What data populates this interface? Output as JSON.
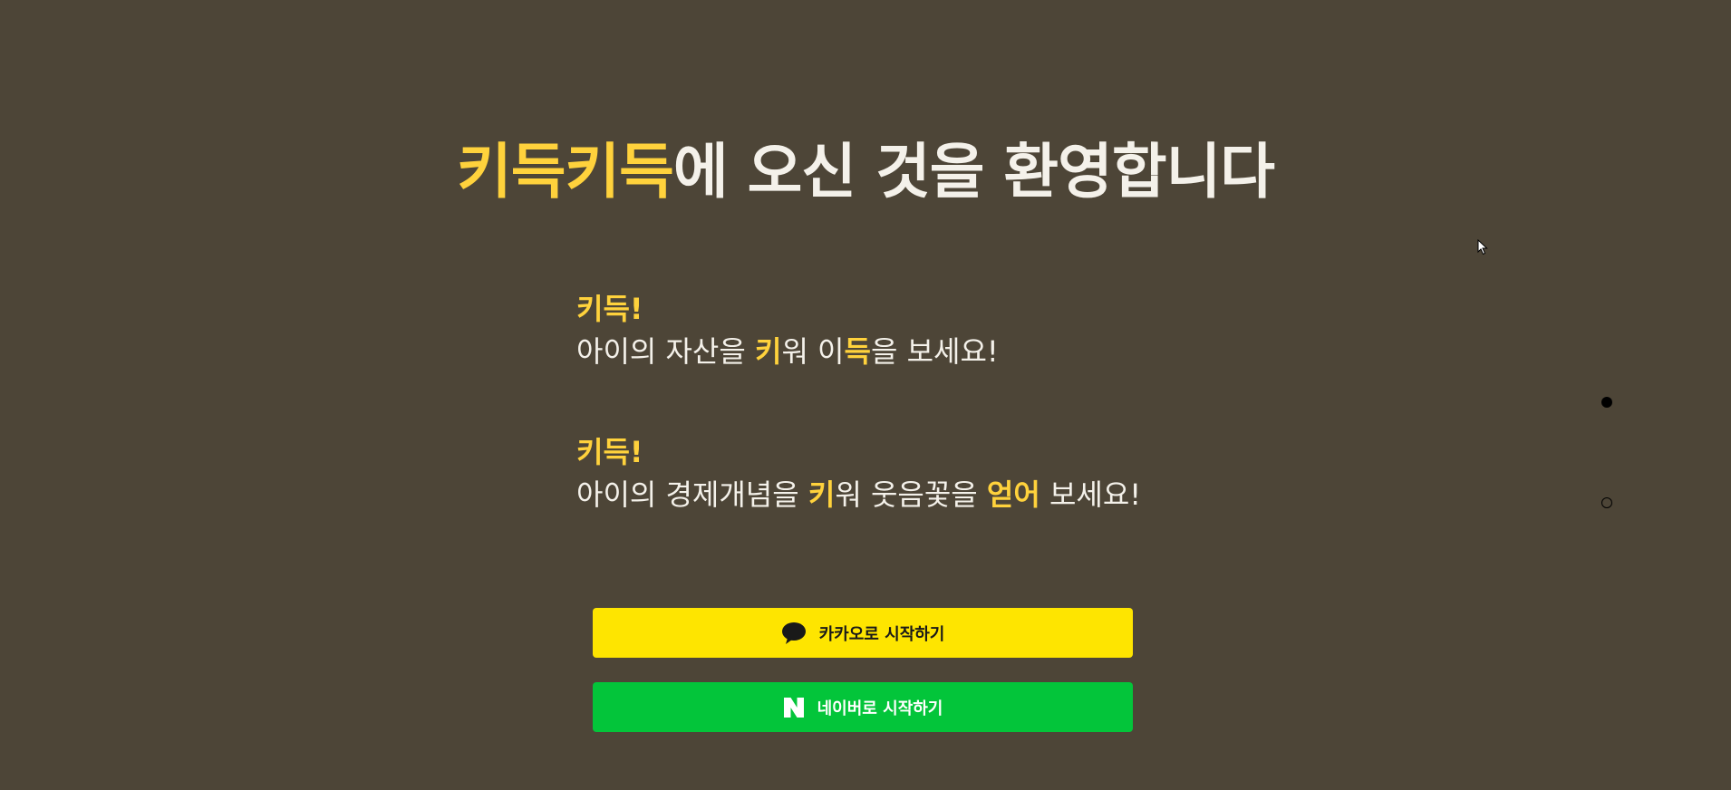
{
  "title": {
    "brand": "키득키득",
    "rest": "에 오신 것을 환영합니다"
  },
  "slogans": [
    {
      "head": "키득!",
      "parts": [
        "아이의 자산을 ",
        "키",
        "워 이",
        "득",
        "을 보세요!"
      ]
    },
    {
      "head": "키득!",
      "parts": [
        "아이의 경제개념을 ",
        "키",
        "워 웃음꽃을 ",
        "얻어",
        " 보세요!"
      ]
    }
  ],
  "buttons": {
    "kakao_label": "카카오로 시작하기",
    "naver_label": "네이버로 시작하기"
  },
  "icons": {
    "kakao": "speech-bubble-icon",
    "naver": "naver-n-icon"
  },
  "pagination": {
    "total": 2,
    "active_index": 0
  },
  "colors": {
    "background": "#4d4537",
    "highlight": "#ffd23c",
    "kakao": "#fee500",
    "naver": "#03c53a"
  }
}
